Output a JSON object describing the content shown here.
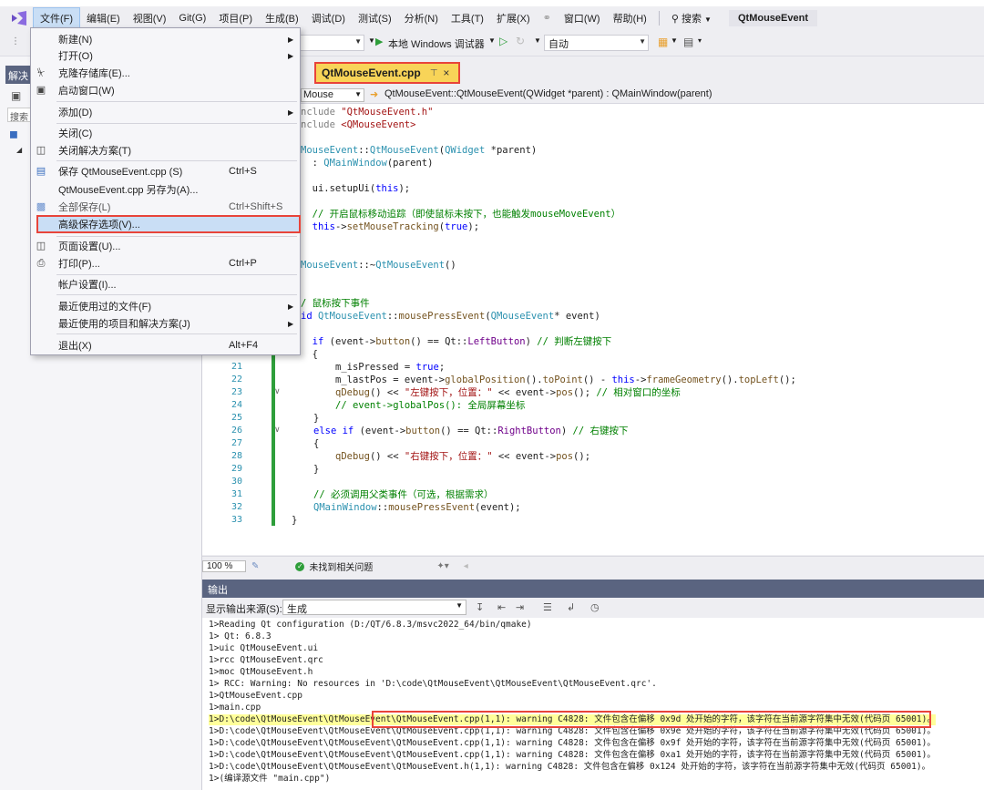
{
  "menubar": {
    "items": [
      "文件(F)",
      "编辑(E)",
      "视图(V)",
      "Git(G)",
      "项目(P)",
      "生成(B)",
      "调试(D)",
      "测试(S)",
      "分析(N)",
      "工具(T)",
      "扩展(X)",
      "窗口(W)",
      "帮助(H)"
    ],
    "search": "搜索",
    "title": "QtMouseEvent"
  },
  "toolbar": {
    "debugger": "本地 Windows 调试器",
    "auto": "自动"
  },
  "leftpanel": {
    "tab": "解决",
    "search": "搜索"
  },
  "filemenu": {
    "items": [
      {
        "label": "新建(N)",
        "shortcut": "",
        "submenu": true,
        "icon": ""
      },
      {
        "label": "打开(O)",
        "shortcut": "",
        "submenu": true,
        "icon": ""
      },
      {
        "label": "克隆存储库(E)...",
        "shortcut": "",
        "submenu": false,
        "icon": "clone-icon"
      },
      {
        "label": "启动窗口(W)",
        "shortcut": "",
        "submenu": false,
        "icon": "window-icon"
      },
      {
        "label": "添加(D)",
        "shortcut": "",
        "submenu": true,
        "icon": ""
      },
      {
        "label": "关闭(C)",
        "shortcut": "",
        "submenu": false,
        "icon": ""
      },
      {
        "label": "关闭解决方案(T)",
        "shortcut": "",
        "submenu": false,
        "icon": "close-solution-icon"
      },
      {
        "label": "保存 QtMouseEvent.cpp (S)",
        "shortcut": "Ctrl+S",
        "submenu": false,
        "icon": "save-icon"
      },
      {
        "label": "QtMouseEvent.cpp 另存为(A)...",
        "shortcut": "",
        "submenu": false,
        "icon": ""
      },
      {
        "label": "全部保存(L)",
        "shortcut": "Ctrl+Shift+S",
        "submenu": false,
        "icon": "save-all-icon"
      },
      {
        "label": "高级保存选项(V)...",
        "shortcut": "",
        "submenu": false,
        "icon": ""
      },
      {
        "label": "页面设置(U)...",
        "shortcut": "",
        "submenu": false,
        "icon": "page-setup-icon"
      },
      {
        "label": "打印(P)...",
        "shortcut": "Ctrl+P",
        "submenu": false,
        "icon": "print-icon"
      },
      {
        "label": "帐户设置(I)...",
        "shortcut": "",
        "submenu": false,
        "icon": ""
      },
      {
        "label": "最近使用过的文件(F)",
        "shortcut": "",
        "submenu": true,
        "icon": ""
      },
      {
        "label": "最近使用的项目和解决方案(J)",
        "shortcut": "",
        "submenu": true,
        "icon": ""
      },
      {
        "label": "退出(X)",
        "shortcut": "Alt+F4",
        "submenu": false,
        "icon": ""
      }
    ]
  },
  "editor": {
    "tab": "QtMouseEvent.cpp",
    "nav_left": "Mouse",
    "nav_right": "QtMouseEvent::QtMouseEvent(QWidget *parent) : QMainWindow(parent)",
    "line_numbers": [
      "21",
      "22",
      "23",
      "24",
      "25",
      "26",
      "27",
      "28",
      "29",
      "30",
      "31",
      "32",
      "33"
    ]
  },
  "edstatus": {
    "zoom": "100 %",
    "issues": "未找到相关问题"
  },
  "output": {
    "header": "输出",
    "source_label": "显示输出来源(S):",
    "source_value": "生成",
    "lines": [
      "1>Reading Qt configuration (D:/QT/6.8.3/msvc2022_64/bin/qmake)",
      "1> Qt: 6.8.3",
      "1>uic QtMouseEvent.ui",
      "1>rcc QtMouseEvent.qrc",
      "1>moc QtMouseEvent.h",
      "1> RCC: Warning: No resources in 'D:\\code\\QtMouseEvent\\QtMouseEvent\\QtMouseEvent.qrc'.",
      "1>QtMouseEvent.cpp",
      "1>main.cpp",
      "1>D:\\code\\QtMouseEvent\\QtMouseEvent\\QtMouseEvent.cpp(1,1): warning C4828: 文件包含在偏移 0x9d 处开始的字符，该字符在当前源字符集中无效(代码页 65001)。",
      "1>D:\\code\\QtMouseEvent\\QtMouseEvent\\QtMouseEvent.cpp(1,1): warning C4828: 文件包含在偏移 0x9e 处开始的字符，该字符在当前源字符集中无效(代码页 65001)。",
      "1>D:\\code\\QtMouseEvent\\QtMouseEvent\\QtMouseEvent.cpp(1,1): warning C4828: 文件包含在偏移 0x9f 处开始的字符，该字符在当前源字符集中无效(代码页 65001)。",
      "1>D:\\code\\QtMouseEvent\\QtMouseEvent\\QtMouseEvent.cpp(1,1): warning C4828: 文件包含在偏移 0xa1 处开始的字符，该字符在当前源字符集中无效(代码页 65001)。",
      "1>D:\\code\\QtMouseEvent\\QtMouseEvent\\QtMouseEvent.h(1,1): warning C4828: 文件包含在偏移 0x124 处开始的字符，该字符在当前源字符集中无效(代码页 65001)。",
      "1>(编译源文件 \"main.cpp\")"
    ]
  }
}
